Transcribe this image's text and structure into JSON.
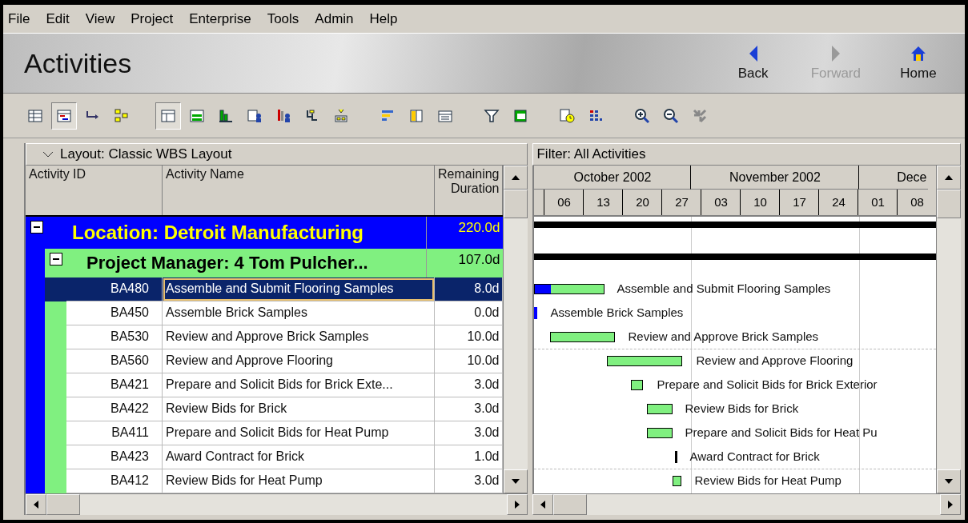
{
  "menu": [
    "File",
    "Edit",
    "View",
    "Project",
    "Enterprise",
    "Tools",
    "Admin",
    "Help"
  ],
  "header": {
    "title": "Activities",
    "nav": [
      {
        "label": "Back",
        "disabled": false
      },
      {
        "label": "Forward",
        "disabled": true
      },
      {
        "label": "Home",
        "disabled": false
      }
    ]
  },
  "toolbar": [
    {
      "selected": false
    },
    {
      "selected": true
    },
    {
      "selected": false
    },
    {
      "selected": false
    },
    {
      "selected": true
    },
    {
      "selected": false
    },
    {
      "selected": false
    },
    {
      "selected": false
    },
    {
      "selected": false
    },
    {
      "selected": false
    },
    {
      "selected": false
    },
    {
      "selected": false
    },
    {
      "selected": false
    },
    {
      "selected": false
    },
    {
      "selected": false
    },
    {
      "selected": false
    },
    {
      "selected": false
    },
    {
      "selected": false
    },
    {
      "selected": false
    },
    {
      "selected": false
    },
    {
      "selected": false
    }
  ],
  "layout_bar": {
    "layout": "Layout: Classic WBS Layout",
    "filter": "Filter: All Activities"
  },
  "table": {
    "columns": [
      "Activity ID",
      "Activity Name",
      "Remaining Duration"
    ],
    "location": {
      "title": "Location: Detroit Manufacturing",
      "duration": "220.0d",
      "expanded": true
    },
    "manager": {
      "title": "Project Manager: 4  Tom Pulcher...",
      "duration": "107.0d",
      "expanded": true
    },
    "rows": [
      {
        "id": "BA480",
        "name": "Assemble and Submit Flooring Samples",
        "duration": "8.0d",
        "selected": true
      },
      {
        "id": "BA450",
        "name": "Assemble Brick Samples",
        "duration": "0.0d",
        "selected": false
      },
      {
        "id": "BA530",
        "name": "Review and Approve Brick Samples",
        "duration": "10.0d",
        "selected": false
      },
      {
        "id": "BA560",
        "name": "Review and Approve Flooring",
        "duration": "10.0d",
        "selected": false
      },
      {
        "id": "BA421",
        "name": "Prepare and Solicit Bids for Brick Exte...",
        "duration": "3.0d",
        "selected": false
      },
      {
        "id": "BA422",
        "name": "Review Bids for Brick",
        "duration": "3.0d",
        "selected": false
      },
      {
        "id": "BA411",
        "name": "Prepare and Solicit Bids for Heat Pump",
        "duration": "3.0d",
        "selected": false
      },
      {
        "id": "BA423",
        "name": "Award Contract for Brick",
        "duration": "1.0d",
        "selected": false
      },
      {
        "id": "BA412",
        "name": "Review Bids for Heat Pump",
        "duration": "3.0d",
        "selected": false
      }
    ]
  },
  "gantt": {
    "months": [
      "October 2002",
      "November 2002",
      "Dece"
    ],
    "weeks": [
      "06",
      "13",
      "20",
      "27",
      "03",
      "10",
      "17",
      "24",
      "01",
      "08"
    ],
    "bars": [
      {
        "label": "Assemble and Submit Flooring Samples",
        "kind": "bar",
        "level": 0.23
      },
      {
        "label": "Assemble Brick Samples",
        "kind": "milestone",
        "completed": true
      },
      {
        "label": "Review and Approve Brick Samples",
        "kind": "bar"
      },
      {
        "label": "Review and Approve Flooring",
        "kind": "bar"
      },
      {
        "label": "Prepare and Solicit Bids for Brick Exterior",
        "kind": "bar"
      },
      {
        "label": "Review Bids for Brick",
        "kind": "bar"
      },
      {
        "label": "Prepare and Solicit Bids for Heat Pu",
        "kind": "bar"
      },
      {
        "label": "Award Contract for Brick",
        "kind": "milestone",
        "completed": false
      },
      {
        "label": "Review Bids for Heat Pump",
        "kind": "bar"
      }
    ]
  }
}
